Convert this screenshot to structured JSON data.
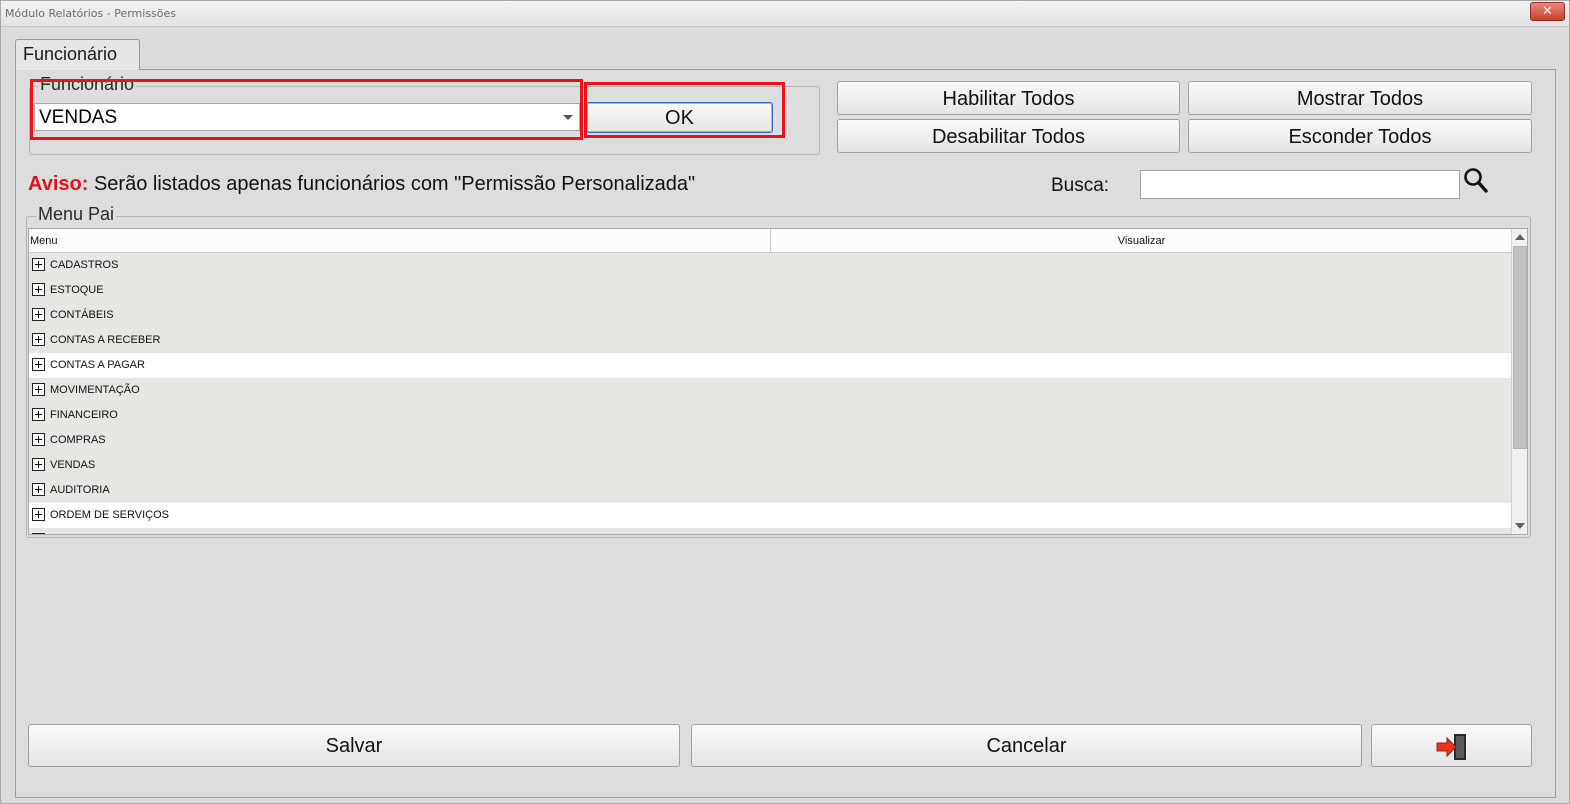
{
  "window": {
    "title": "Módulo Relatórios - Permissões",
    "close_label": "✕"
  },
  "tab": {
    "label": "Funcionário"
  },
  "funcionario_group": {
    "title": "Funcionário",
    "selected": "VENDAS",
    "ok_label": "OK"
  },
  "actions": {
    "habilitar": "Habilitar Todos",
    "desabilitar": "Desabilitar Todos",
    "mostrar": "Mostrar Todos",
    "esconder": "Esconder Todos"
  },
  "aviso": {
    "label": "Aviso:",
    "text": " Serão listados apenas funcionários com \"Permissão Personalizada\""
  },
  "busca": {
    "label": "Busca:",
    "value": ""
  },
  "menu_group": {
    "title": "Menu Pai",
    "columns": [
      "Menu",
      "Visualizar"
    ],
    "items": [
      {
        "label": "CADASTROS"
      },
      {
        "label": "ESTOQUE"
      },
      {
        "label": "CONTÁBEIS"
      },
      {
        "label": "CONTAS A RECEBER"
      },
      {
        "label": "CONTAS A PAGAR"
      },
      {
        "label": "MOVIMENTAÇÃO"
      },
      {
        "label": "FINANCEIRO"
      },
      {
        "label": "COMPRAS"
      },
      {
        "label": "VENDAS"
      },
      {
        "label": "AUDITORIA"
      },
      {
        "label": "ORDEM DE SERVIÇOS"
      },
      {
        "label": ""
      }
    ]
  },
  "footer": {
    "salvar": "Salvar",
    "cancelar": "Cancelar",
    "exit_icon": "exit-door-icon"
  },
  "colors": {
    "highlight": "#e8131c",
    "aviso": "#e0141b",
    "row_alt": "#e8e6e2"
  }
}
